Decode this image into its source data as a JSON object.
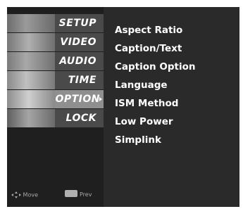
{
  "menu": {
    "items": [
      {
        "label": "SETUP",
        "icon": "setup-thumbnail"
      },
      {
        "label": "VIDEO",
        "icon": "video-thumbnail"
      },
      {
        "label": "AUDIO",
        "icon": "audio-thumbnail"
      },
      {
        "label": "TIME",
        "icon": "time-thumbnail"
      },
      {
        "label": "OPTION",
        "icon": "option-thumbnail",
        "active": true
      },
      {
        "label": "LOCK",
        "icon": "lock-thumbnail"
      }
    ]
  },
  "submenu": {
    "items": [
      {
        "label": "Aspect Ratio"
      },
      {
        "label": "Caption/Text"
      },
      {
        "label": "Caption Option"
      },
      {
        "label": "Language"
      },
      {
        "label": "ISM Method"
      },
      {
        "label": "Low Power"
      },
      {
        "label": "Simplink"
      }
    ]
  },
  "hints": {
    "move": "Move",
    "prev": "Prev"
  },
  "colors": {
    "sidebar": "#1f1f1f",
    "panel": "#2a2a2a",
    "active": "#8f8f8f",
    "text": "#ffffff"
  }
}
